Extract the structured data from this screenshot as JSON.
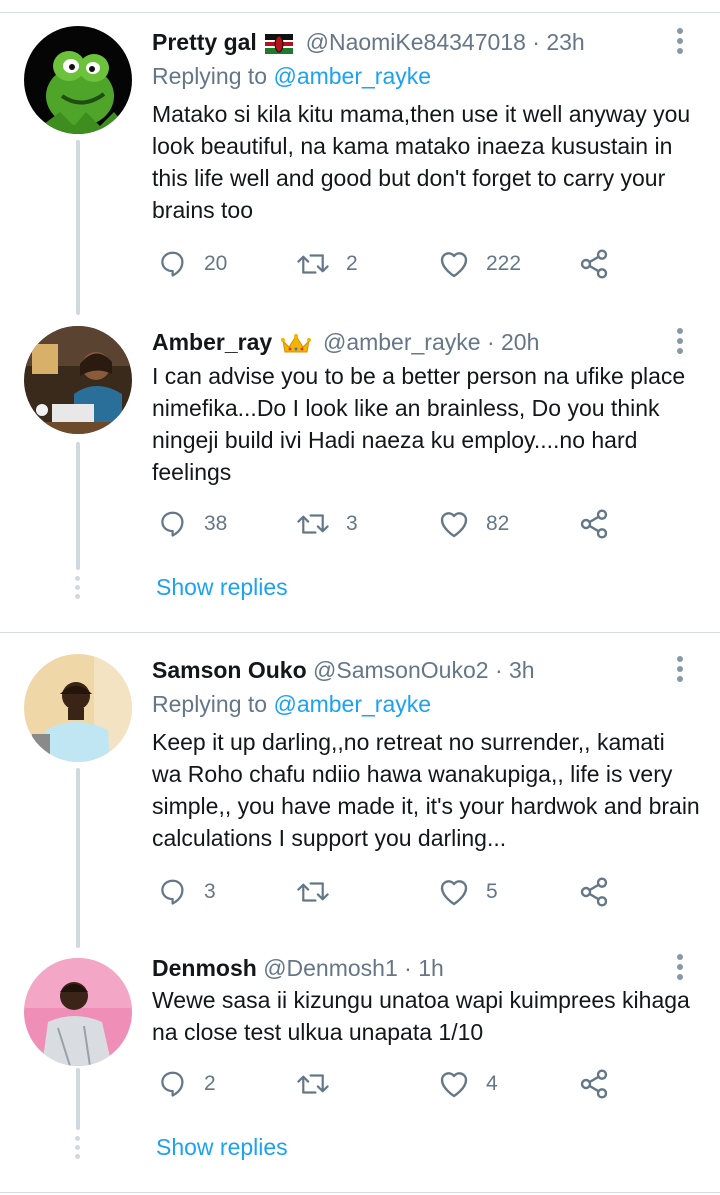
{
  "tweets": [
    {
      "name": "Pretty gal",
      "handle": "@NaomiKe84347018",
      "time": "· 23h",
      "replying_label": "Replying to",
      "replying_to": "@amber_rayke",
      "text": "Matako si kila kitu mama,then use it well anyway you look beautiful, na kama matako inaeza kusustain in this life well and good but don't forget to carry your brains too",
      "replies": "20",
      "retweets": "2",
      "likes": "222",
      "avatar_icon": "kermit-avatar",
      "badge_icon": "kenya-flag"
    },
    {
      "name": "Amber_ray",
      "handle": "@amber_rayke",
      "time": "· 20h",
      "text": "I can advise you to be a better person na ufike place nimefika...Do I look like an brainless, Do you think ningeji build ivi Hadi naeza ku employ....no hard feelings",
      "replies": "38",
      "retweets": "3",
      "likes": "82",
      "avatar_icon": "woman-with-laptop-avatar",
      "badge_icon": "crown-emoji"
    },
    {
      "name": "Samson Ouko",
      "handle": "@SamsonOuko2",
      "time": "· 3h",
      "replying_label": "Replying to",
      "replying_to": "@amber_rayke",
      "text": "Keep it up darling,,no retreat no surrender,, kamati wa Roho chafu ndiio hawa wanakupiga,, life is very simple,, you have made it, it's your hardwok and brain calculations I support you darling...",
      "replies": "3",
      "retweets": "",
      "likes": "5",
      "avatar_icon": "man-avatar"
    },
    {
      "name": "Denmosh",
      "handle": "@Denmosh1",
      "time": "· 1h",
      "text": "Wewe sasa ii kizungu unatoa wapi kuimprees kihaga na close test ulkua unapata 1/10",
      "replies": "2",
      "retweets": "",
      "likes": "4",
      "avatar_icon": "young-man-avatar"
    }
  ],
  "show_replies_label": "Show replies",
  "icons": {
    "reply": "reply-icon",
    "retweet": "retweet-icon",
    "like": "heart-icon",
    "share": "share-icon",
    "more": "more-vertical-icon"
  },
  "colors": {
    "link": "#1da1f2",
    "secondary_text": "#657786",
    "thread_line": "#cfd9de"
  }
}
